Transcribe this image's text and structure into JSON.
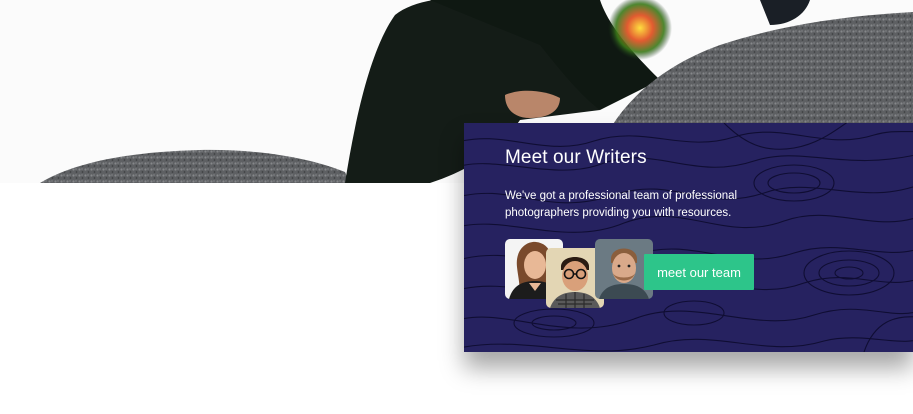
{
  "card": {
    "title": "Meet our Writers",
    "description": "We've got a professional team of professional photographers providing you with resources.",
    "button_label": "meet our team"
  },
  "colors": {
    "card_background": "#262260",
    "button_background": "#2dc58a",
    "text": "#ffffff"
  },
  "avatars": [
    {
      "icon": "woman-portrait"
    },
    {
      "icon": "man-glasses-portrait"
    },
    {
      "icon": "man-beard-portrait"
    }
  ]
}
